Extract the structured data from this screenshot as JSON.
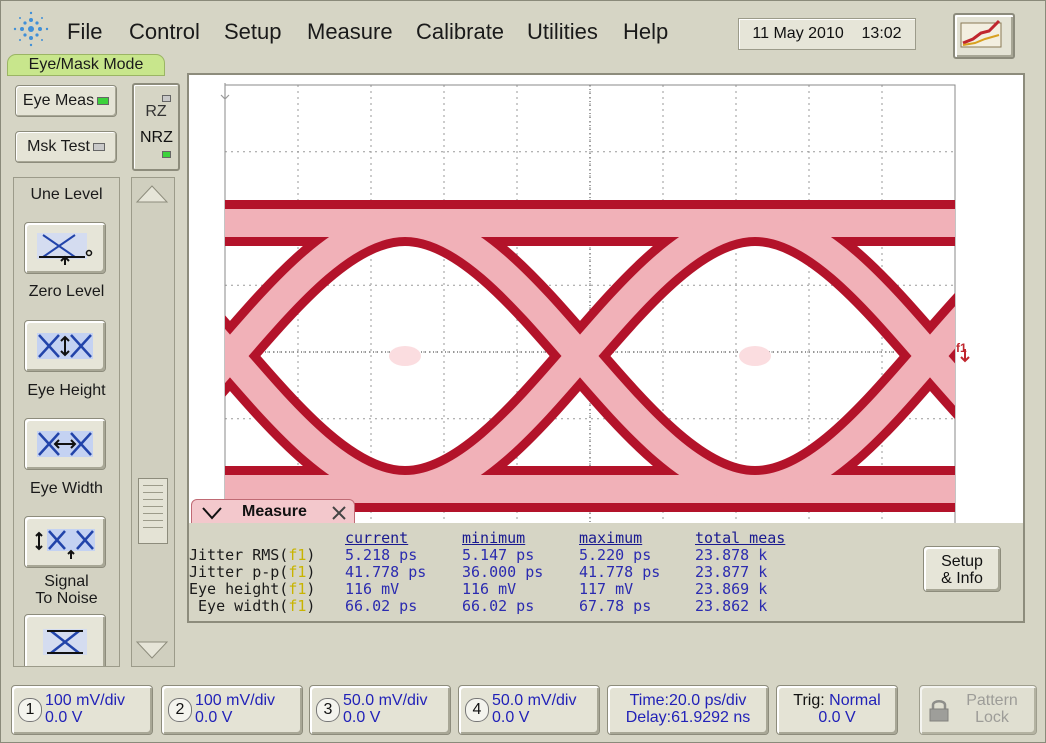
{
  "menu": {
    "items": [
      "File",
      "Control",
      "Setup",
      "Measure",
      "Calibrate",
      "Utilities",
      "Help"
    ],
    "date": "11 May 2010",
    "time": "13:02"
  },
  "mode_tab": "Eye/Mask Mode",
  "left": {
    "eye_meas": "Eye Meas",
    "msk_test": "Msk Test",
    "rz": "RZ",
    "nrz": "NRZ",
    "tools": [
      "Une Level",
      "Zero Level",
      "Eye Height",
      "Eye Width",
      "Signal To Noise"
    ],
    "signal_noise_line1": "Signal",
    "signal_noise_line2": "To Noise"
  },
  "display": {
    "marker": "f1"
  },
  "measure": {
    "tab_label": "Measure",
    "headers": [
      "current",
      "minimum",
      "maximum",
      "total meas"
    ],
    "rows": [
      {
        "name": "Jitter RMS(",
        "current": "5.218 ps",
        "minimum": "5.147 ps",
        "maximum": "5.220 ps",
        "total": "23.878 k"
      },
      {
        "name": "Jitter p-p(",
        "current": "41.778 ps",
        "minimum": "36.000 ps",
        "maximum": "41.778 ps",
        "total": "23.877 k"
      },
      {
        "name": "Eye height(",
        "current": "116 mV",
        "minimum": "116 mV",
        "maximum": "117 mV",
        "total": "23.869 k"
      },
      {
        "name": " Eye width(",
        "current": "66.02 ps",
        "minimum": "66.02 ps",
        "maximum": "67.78 ps",
        "total": "23.862 k"
      }
    ],
    "f1": "f1",
    "close": ")",
    "setup_line1": "Setup",
    "setup_line2": "& Info"
  },
  "bottom": {
    "channels": [
      {
        "num": "1",
        "scale": "100 mV/div",
        "offset": "0.0 V"
      },
      {
        "num": "2",
        "scale": "100 mV/div",
        "offset": "0.0 V"
      },
      {
        "num": "3",
        "scale": "50.0 mV/div",
        "offset": "0.0 V"
      },
      {
        "num": "4",
        "scale": "50.0 mV/div",
        "offset": "0.0 V"
      }
    ],
    "time": "Time:20.0 ps/div",
    "delay": "Delay:61.9292 ns",
    "trig_label": "Trig:",
    "trig_value": "Normal",
    "trig_level": "0.0 V",
    "pattern": "Pattern",
    "lock": "Lock"
  },
  "colors": {
    "eye_outer": "#b3132a",
    "eye_inner": "#f1b1b8",
    "accent_led": "#3cd23c",
    "mode_tab": "#c8e68c"
  }
}
